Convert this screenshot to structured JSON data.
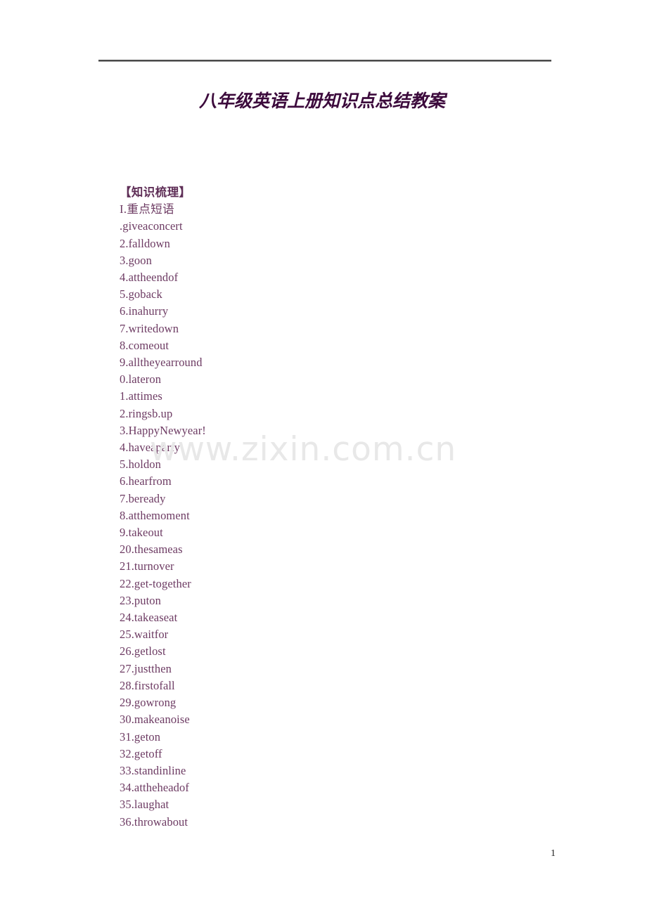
{
  "document": {
    "title": "八年级英语上册知识点总结教案",
    "page_number": "1",
    "watermark": "www.zixin.com.cn",
    "title_color": "#3c0a3c",
    "body_color": "#6d3b63",
    "watermark_color": "#e8e8e8",
    "rule_color": "#4a4a4a"
  },
  "body": {
    "section_heading": "【知识梳理】",
    "subsection_heading": "I.重点短语",
    "lines": [
      ".giveaconcert",
      "2.falldown",
      "3.goon",
      "4.attheendof",
      "5.goback",
      "6.inahurry",
      "7.writedown",
      "8.comeout",
      "9.alltheyearround",
      "0.lateron",
      "1.attimes",
      "2.ringsb.up",
      "3.HappyNewyear!",
      "4.haveaparty",
      "5.holdon",
      "6.hearfrom",
      "7.beready",
      "8.atthemoment",
      "9.takeout",
      "20.thesameas",
      "21.turnover",
      "22.get-together",
      "23.puton",
      "24.takeaseat",
      "25.waitfor",
      "26.getlost",
      "27.justthen",
      "28.firstofall",
      "29.gowrong",
      "30.makeanoise",
      "31.geton",
      "32.getoff",
      "33.standinline",
      "34.attheheadof",
      "35.laughat",
      "36.throwabout"
    ]
  }
}
